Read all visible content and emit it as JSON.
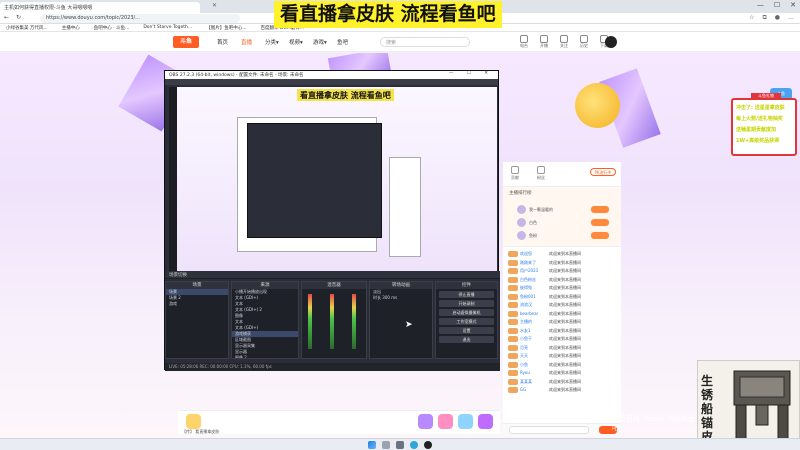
{
  "browser": {
    "tab_title": "主机如何获得直播权限-斗鱼 大哥嗯嗯嗯",
    "url": "https://www.douyu.com/topic/2023/...",
    "bookmarks": [
      "小绿谷集美 万代风...",
      "主播中心",
      "鱼吧中心 · 斗鱼...",
      "Don't Starve Togeth...",
      "【图片】鱼吧中心...",
      "百度翻译 DOM翻译..."
    ]
  },
  "site": {
    "logo": "斗鱼",
    "nav": [
      "首页",
      "直播",
      "分类▾",
      "视频▾",
      "游戏▾",
      "鱼吧"
    ],
    "active_nav": "直播",
    "search_placeholder": "搜索",
    "icons": [
      "电台",
      "开播",
      "关注",
      "历史",
      "下载"
    ]
  },
  "overlay": {
    "title": "看直播拿皮肤 流程看鱼吧",
    "right_panel_tag": "斗鱼礼物",
    "right_panel_badge": "斗鱼",
    "right_panel_lines": [
      "冲击了: 送星星拿皮肤",
      "每上火箭/送礼物抽奖",
      "送锤星期贡献度加",
      "1W+高级奖品获得"
    ]
  },
  "obs": {
    "title": "OBS 27.2.3 (64-bit, windows) - 配置文件: 未命名 - 场景: 未命名",
    "inner_banner": "看直播拿皮肤 流程看鱼吧",
    "scene_bar": "场景切换",
    "docks": {
      "scenes": {
        "title": "场景",
        "items": [
          "场景",
          "场景 2",
          "游戏"
        ]
      },
      "sources": {
        "title": "来源",
        "items": [
          "小播开始播放出现",
          "文本 (GDI+)",
          "文本",
          "文本 (GDI+) 2",
          "图像",
          "文本",
          "文本 (GDI+)",
          "游戏捕获",
          "区域截图",
          "显示器采集",
          "显示器",
          "图像 2",
          "音频"
        ]
      },
      "mixer": {
        "title": "混音器",
        "channels": [
          "小播开始播放出现",
          "桌面音频",
          "麦克风"
        ]
      },
      "transitions": {
        "title": "转场动画",
        "type": "淡出",
        "duration_label": "时长",
        "duration": "300 ms"
      },
      "controls": {
        "title": "控件",
        "buttons": [
          "停止直播",
          "开始录制",
          "启动虚拟摄像机",
          "工作室模式",
          "设置",
          "退出"
        ]
      }
    },
    "status": "LIVE: 05:28:06   REC: 00:00:00   CPU: 1.3%, 60.00 fps"
  },
  "sidebar": {
    "top_items": [
      "贡献",
      "粉丝"
    ],
    "top_pill": "PK进行中",
    "rank_title": "主播排行榜",
    "rank_rows": [
      "我一颗温暖的",
      "白色",
      "鱼粉"
    ],
    "chats": [
      {
        "who": "欢迎您",
        "msg": "欢迎来到本直播间"
      },
      {
        "who": "刚刚来了",
        "msg": "欢迎来到本直播间"
      },
      {
        "who": "用户2023",
        "msg": "欢迎来到本直播间"
      },
      {
        "who": "白色粉丝",
        "msg": "欢迎来到本直播间"
      },
      {
        "who": "彼得兔",
        "msg": "欢迎来到本直播间"
      },
      {
        "who": "鱼粉001",
        "msg": "欢迎来到本直播间"
      },
      {
        "who": "流浪汉",
        "msg": "欢迎来到本直播间"
      },
      {
        "who": "bearbear",
        "msg": "欢迎来到本直播间"
      },
      {
        "who": "主播的",
        "msg": "欢迎来到本直播间"
      },
      {
        "who": "水友1",
        "msg": "欢迎来到本直播间"
      },
      {
        "who": "小鱼干",
        "msg": "欢迎来到本直播间"
      },
      {
        "who": "月亮",
        "msg": "欢迎来到本直播间"
      },
      {
        "who": "天天",
        "msg": "欢迎来到本直播间"
      },
      {
        "who": "小鱼",
        "msg": "欢迎来到本直播间"
      },
      {
        "who": "Ryou",
        "msg": "欢迎来到本直播间"
      },
      {
        "who": "某某某",
        "msg": "欢迎来到本直播间"
      },
      {
        "who": "GG",
        "msg": "欢迎来到本直播间"
      }
    ]
  },
  "gift_bar": {
    "label": "【传】 看直播拿皮肤"
  },
  "camera": {
    "text": "生锈船锚皮肤"
  },
  "watermark": "斗鱼直播 Steam 流程看鱼吧",
  "colors": {
    "accent": "#ff5d23",
    "overlay_yellow": "#fff12a",
    "obs_bg": "#2b2e38"
  }
}
